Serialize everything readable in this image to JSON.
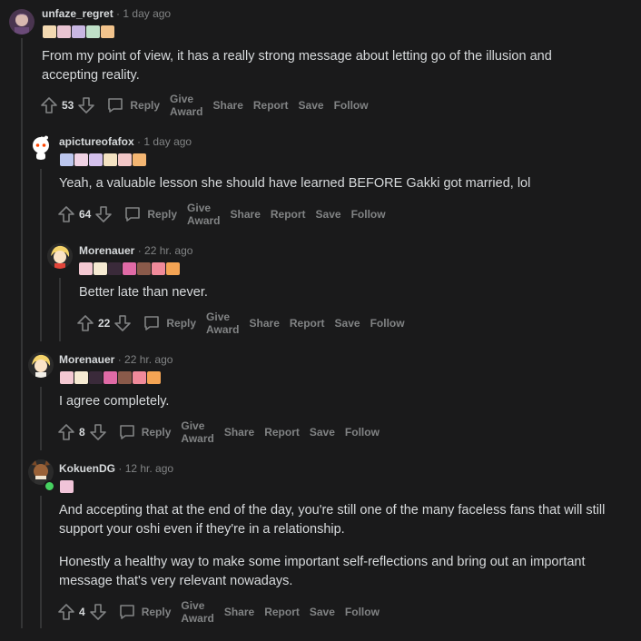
{
  "actions": {
    "reply": "Reply",
    "give_award": "Give Award",
    "share": "Share",
    "report": "Report",
    "save": "Save",
    "follow": "Follow"
  },
  "colors": {
    "background": "#1a1a1b",
    "text": "#d7dadc",
    "muted": "#818384",
    "thread_line": "#343536",
    "online": "#46d160"
  },
  "comments": [
    {
      "username": "unfaze_regret",
      "separator": "·",
      "time": "1 day ago",
      "body": [
        "From my point of view, it has a really strong message about letting go of the illusion and accepting reality."
      ],
      "score": "53"
    },
    {
      "username": "apictureofafox",
      "separator": "·",
      "time": "1 day ago",
      "body": [
        "Yeah, a valuable lesson she should have learned BEFORE Gakki got married, lol"
      ],
      "score": "64"
    },
    {
      "username": "Morenauer",
      "separator": "·",
      "time": "22 hr. ago",
      "body": [
        "Better late than never."
      ],
      "score": "22"
    },
    {
      "username": "Morenauer",
      "separator": "·",
      "time": "22 hr. ago",
      "body": [
        "I agree completely."
      ],
      "score": "8"
    },
    {
      "username": "KokuenDG",
      "separator": "·",
      "time": "12 hr. ago",
      "body": [
        "And accepting that at the end of the day, you're still one of the many faceless fans that will still support your oshi even if they're in a relationship.",
        "Honestly a healthy way to make some important self-reflections and bring out an important message that's very relevant nowadays."
      ],
      "score": "4"
    }
  ]
}
